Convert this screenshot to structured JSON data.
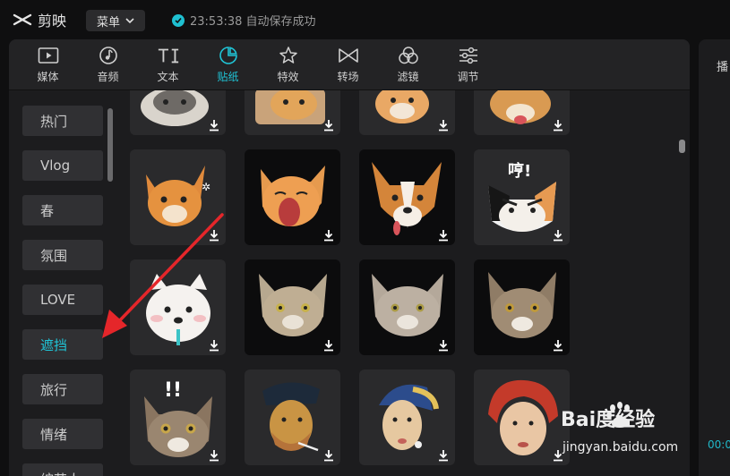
{
  "app": {
    "name": "剪映",
    "menu_label": "菜单",
    "save_status": "23:53:38 自动保存成功"
  },
  "tabs": [
    {
      "label": "媒体",
      "icon": "media-icon",
      "active": false
    },
    {
      "label": "音频",
      "icon": "audio-icon",
      "active": false
    },
    {
      "label": "文本",
      "icon": "text-icon",
      "active": false
    },
    {
      "label": "贴纸",
      "icon": "sticker-icon",
      "active": true
    },
    {
      "label": "特效",
      "icon": "effects-icon",
      "active": false
    },
    {
      "label": "转场",
      "icon": "transition-icon",
      "active": false
    },
    {
      "label": "滤镜",
      "icon": "filter-icon",
      "active": false
    },
    {
      "label": "调节",
      "icon": "adjust-icon",
      "active": false
    }
  ],
  "categories": [
    {
      "label": "热门",
      "active": false
    },
    {
      "label": "Vlog",
      "active": false
    },
    {
      "label": "春",
      "active": false
    },
    {
      "label": "氛围",
      "active": false
    },
    {
      "label": "LOVE",
      "active": false
    },
    {
      "label": "遮挡",
      "active": true
    },
    {
      "label": "旅行",
      "active": false
    },
    {
      "label": "情绪",
      "active": false
    },
    {
      "label": "综艺人",
      "active": false
    }
  ],
  "sticker_tiles": [
    {
      "name": "cat-face-sticker"
    },
    {
      "name": "cat-face-sticker"
    },
    {
      "name": "cat-face-sticker"
    },
    {
      "name": "dog-face-sticker"
    },
    {
      "name": "angry-cat-sticker"
    },
    {
      "name": "yawning-cat-sticker"
    },
    {
      "name": "corgi-face-sticker"
    },
    {
      "name": "hmph-cat-sticker",
      "text": "哼!"
    },
    {
      "name": "samoyed-face-sticker"
    },
    {
      "name": "tabby-cat-face-sticker"
    },
    {
      "name": "grey-cat-face-sticker"
    },
    {
      "name": "tabby-cat-face-sticker"
    },
    {
      "name": "surprised-cat-sticker",
      "text": "!!"
    },
    {
      "name": "van-gogh-face-sticker"
    },
    {
      "name": "pearl-earring-face-sticker"
    },
    {
      "name": "red-headscarf-face-sticker"
    }
  ],
  "right_panel": {
    "label": "播",
    "timecode": "00:0"
  },
  "watermark": {
    "brand": "Bai度经验",
    "url": "jingyan.baidu.com"
  },
  "colors": {
    "accent": "#20c4d6",
    "arrow": "#e5262a"
  }
}
